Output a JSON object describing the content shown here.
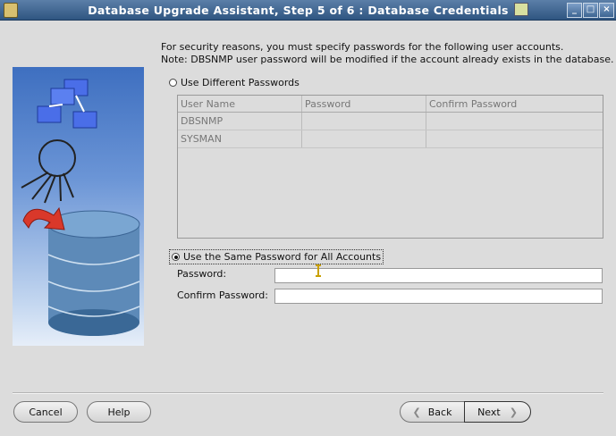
{
  "window": {
    "title": "Database Upgrade Assistant, Step 5 of 6 : Database Credentials",
    "min_glyph": "_",
    "max_glyph": "□",
    "close_glyph": "×"
  },
  "intro": {
    "line1": "For security reasons, you must specify passwords for the following user accounts.",
    "line2": "Note: DBSNMP user password will be modified if the account already exists in the database."
  },
  "options": {
    "different_label": "Use Different Passwords",
    "different_selected": false,
    "same_label": "Use the Same Password for All Accounts",
    "same_selected": true
  },
  "table": {
    "headers": [
      "User Name",
      "Password",
      "Confirm Password"
    ],
    "rows": [
      [
        "DBSNMP",
        "",
        ""
      ],
      [
        "SYSMAN",
        "",
        ""
      ]
    ]
  },
  "form": {
    "password_label": "Password:",
    "password_value": "",
    "confirm_label": "Confirm Password:",
    "confirm_value": ""
  },
  "buttons": {
    "cancel": "Cancel",
    "help": "Help",
    "back": "Back",
    "next": "Next"
  },
  "colors": {
    "title_bar": "#2f5581",
    "art_gradient_top": "#3e6fc0",
    "dialog_bg": "#dcdcdc"
  }
}
